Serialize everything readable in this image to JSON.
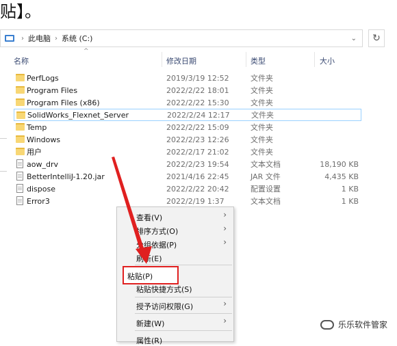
{
  "top_text": "贴】。",
  "address": {
    "crumbs": [
      "此电脑",
      "系统 (C:)"
    ]
  },
  "columns": {
    "name": "名称",
    "modified": "修改日期",
    "type": "类型",
    "size": "大小"
  },
  "files": [
    {
      "name": "PerfLogs",
      "date": "2019/3/19 12:52",
      "type": "文件夹",
      "size": "",
      "kind": "folder"
    },
    {
      "name": "Program Files",
      "date": "2022/2/22 18:01",
      "type": "文件夹",
      "size": "",
      "kind": "folder"
    },
    {
      "name": "Program Files (x86)",
      "date": "2022/2/22 15:30",
      "type": "文件夹",
      "size": "",
      "kind": "folder"
    },
    {
      "name": "SolidWorks_Flexnet_Server",
      "date": "2022/2/24 12:17",
      "type": "文件夹",
      "size": "",
      "kind": "folder"
    },
    {
      "name": "Temp",
      "date": "2022/2/22 15:09",
      "type": "文件夹",
      "size": "",
      "kind": "folder"
    },
    {
      "name": "Windows",
      "date": "2022/2/23 12:26",
      "type": "文件夹",
      "size": "",
      "kind": "folder"
    },
    {
      "name": "用户",
      "date": "2022/2/17 21:02",
      "type": "文件夹",
      "size": "",
      "kind": "folder"
    },
    {
      "name": "aow_drv",
      "date": "2022/2/23 19:54",
      "type": "文本文档",
      "size": "18,190 KB",
      "kind": "file"
    },
    {
      "name": "BetterIntelliJ-1.20.jar",
      "date": "2021/4/16 22:45",
      "type": "JAR 文件",
      "size": "4,435 KB",
      "kind": "file"
    },
    {
      "name": "dispose",
      "date": "2022/2/22 20:42",
      "type": "配置设置",
      "size": "1 KB",
      "kind": "file"
    },
    {
      "name": "Error3",
      "date": "2022/2/19 1:37",
      "type": "文本文档",
      "size": "1 KB",
      "kind": "file"
    }
  ],
  "context_menu": {
    "view": "查看(V)",
    "sort": "排序方式(O)",
    "group": "分组依据(P)",
    "refresh": "刷新(E)",
    "paste": "粘贴(P)",
    "paste_shortcut": "粘贴快捷方式(S)",
    "give_access": "授予访问权限(G)",
    "new": "新建(W)",
    "properties": "属性(R)"
  },
  "watermark": "乐乐软件管家",
  "colors": {
    "annotation_red": "#e02020",
    "folder_yellow": "#f8d775",
    "selection_border": "#99d1ff"
  }
}
